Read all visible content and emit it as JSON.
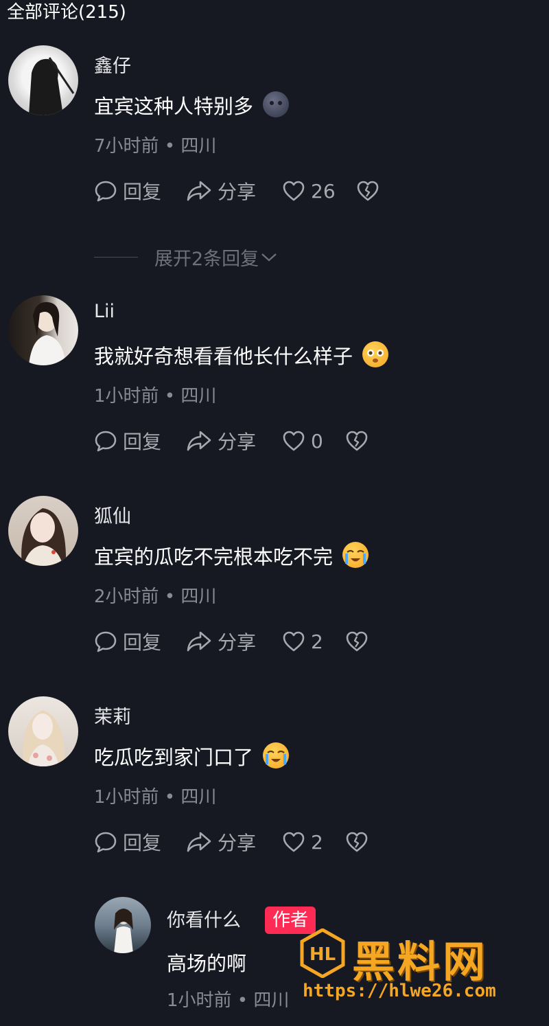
{
  "header": {
    "title": "全部评论(215)"
  },
  "labels": {
    "reply": "回复",
    "share": "分享"
  },
  "comments": [
    {
      "user": "鑫仔",
      "text": "宜宾这种人特别多",
      "emoji": "dark-moon-face-emoji",
      "meta": "7小时前 • 四川",
      "likes": "26",
      "expand": "展开2条回复"
    },
    {
      "user": "Lii",
      "text": "我就好奇想看看他长什么样子",
      "emoji": "pleading-face-emoji",
      "meta": "1小时前 • 四川",
      "likes": "0"
    },
    {
      "user": "狐仙",
      "text": "宜宾的瓜吃不完根本吃不完",
      "emoji": "crying-loudly-emoji",
      "meta": "2小时前 • 四川",
      "likes": "2"
    },
    {
      "user": "茉莉",
      "text": "吃瓜吃到家门口了",
      "emoji": "crying-loudly-emoji",
      "meta": "1小时前 • 四川",
      "likes": "2"
    }
  ],
  "reply": {
    "user": "你看什么",
    "tag": "作者",
    "text": "高场的啊",
    "meta": "1小时前 • 四川"
  },
  "watermark": {
    "title": "黑料网",
    "url": "https://hlwe26.com",
    "logo": "HL"
  },
  "colors": {
    "background": "#161822",
    "author_tag": "#fe2c55",
    "watermark": "#f5a623"
  }
}
